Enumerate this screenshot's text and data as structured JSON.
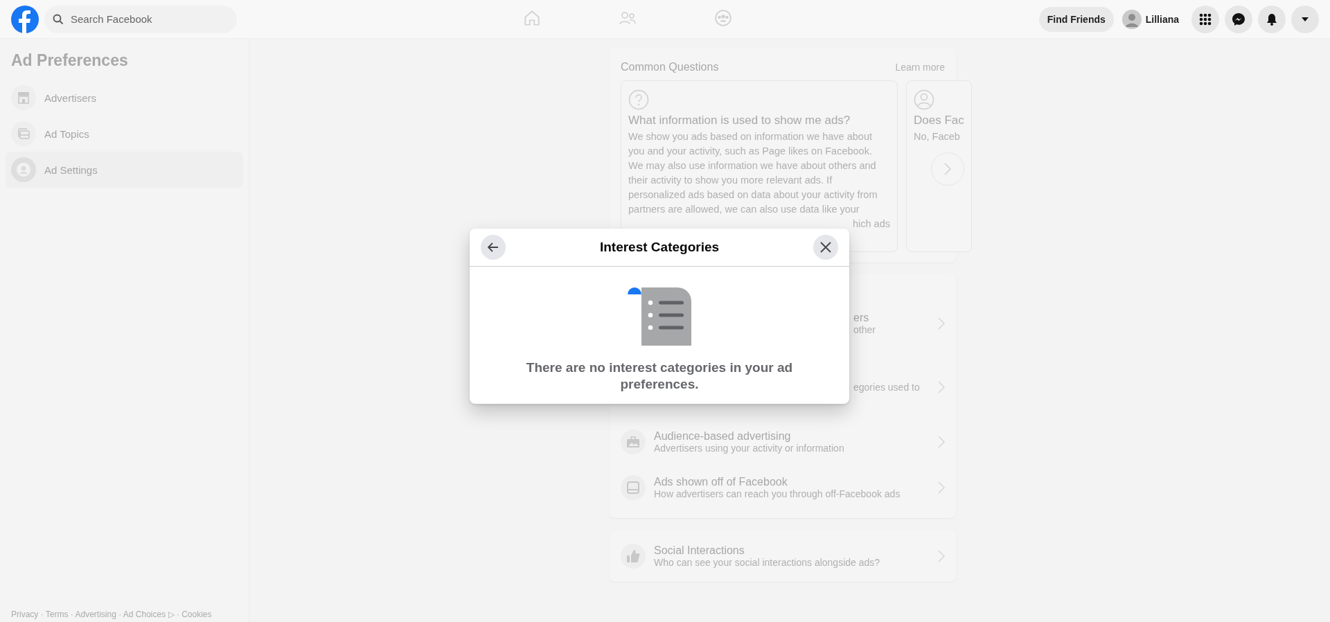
{
  "topbar": {
    "search": {
      "placeholder": "Search Facebook"
    },
    "nav": [
      {
        "kind": "home",
        "selected": false
      },
      {
        "kind": "friends",
        "selected": false
      },
      {
        "kind": "groups",
        "selected": false
      }
    ],
    "find_friends": "Find Friends",
    "user": "Lilliana"
  },
  "sidebar": {
    "title": "Ad Preferences",
    "items": [
      {
        "kind": "store",
        "label": "Advertisers",
        "selected": false
      },
      {
        "kind": "topics",
        "label": "Ad Topics",
        "selected": false
      },
      {
        "kind": "settings",
        "label": "Ad Settings",
        "selected": true
      }
    ],
    "footer": "Privacy · Terms · Advertising · Ad Choices ▷ · Cookies"
  },
  "common_questions": {
    "title": "Common Questions",
    "link": "Learn more",
    "cards": [
      {
        "kind": "question",
        "title": "What information is used to show me ads?",
        "lines": [
          "We show you ads based on information we have about",
          "you and your activity, such as Page likes on Facebook.",
          "We may also use information we have about others and",
          "their activity to show you more relevant ads. If",
          "personalized ads based on data about your activity from",
          "partners are allowed, we can also use data like your"
        ],
        "tail": "hich ads"
      },
      {
        "kind": "person",
        "title": "Does Fac",
        "lines": [
          "No, Faceb"
        ]
      }
    ]
  },
  "settings": [
    {
      "kind": "partial",
      "title": "ers",
      "subtitle": "other"
    },
    {
      "kind": "partial",
      "subtitle": "egories used to"
    },
    {
      "kind": "audience",
      "title": "Audience-based advertising",
      "subtitle": "Advertisers using your activity or information"
    },
    {
      "kind": "offsite",
      "title": "Ads shown off of Facebook",
      "subtitle": "How advertisers can reach you through off-Facebook ads"
    }
  ],
  "social": {
    "kind": "like",
    "title": "Social Interactions",
    "subtitle": "Who can see your social interactions alongside ads?"
  },
  "dialog": {
    "title": "Interest Categories",
    "message": "There are no interest categories in your ad preferences."
  }
}
